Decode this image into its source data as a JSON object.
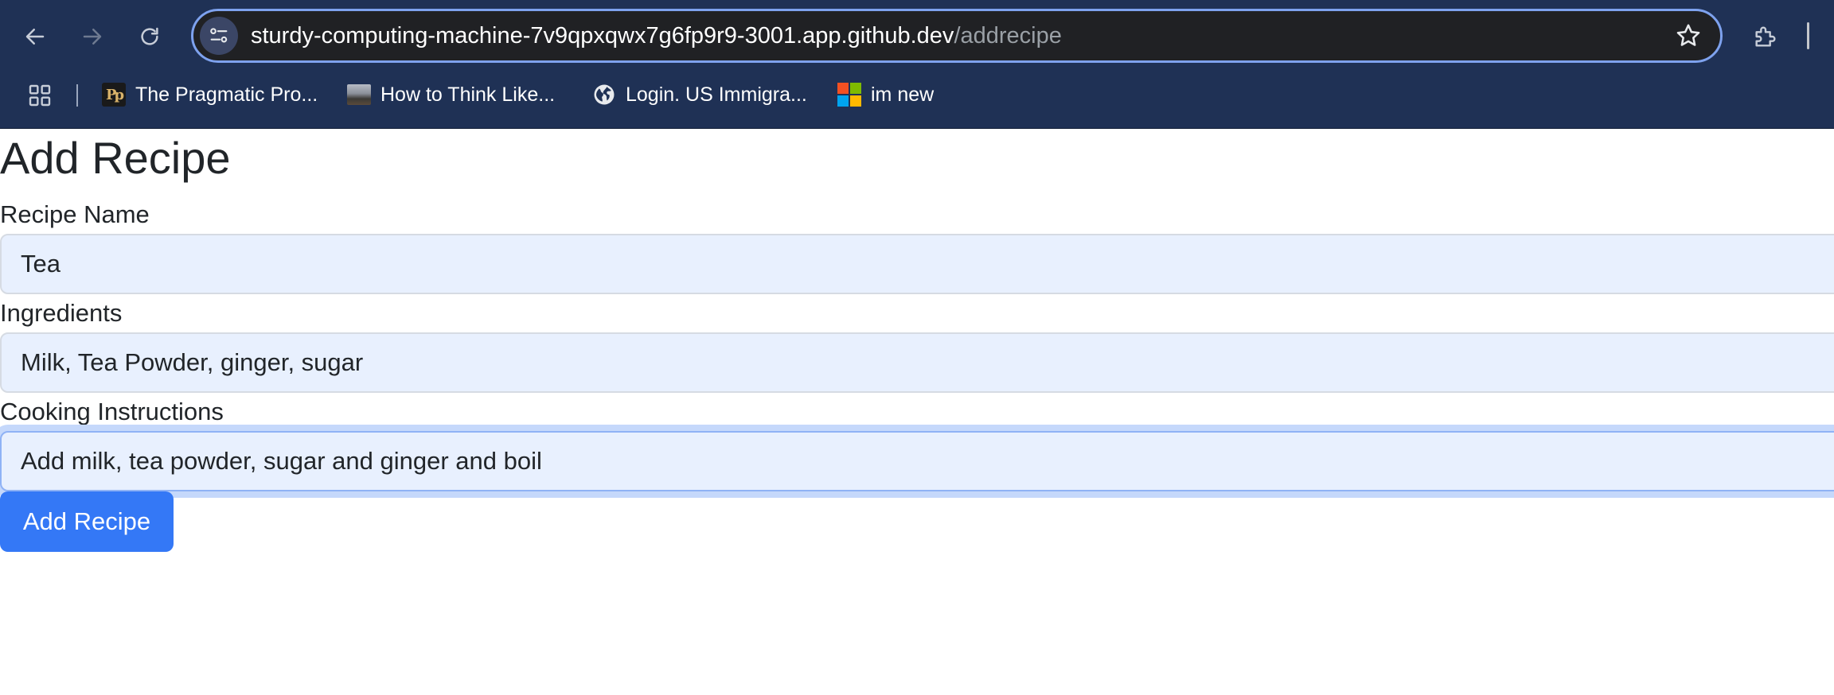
{
  "browser": {
    "url_host": "sturdy-computing-machine-7v9qpxqwx7g6fp9r9-3001.app.github.dev",
    "url_path": "/addrecipe",
    "icons": {
      "back": "arrow-left-icon",
      "forward": "arrow-right-icon",
      "reload": "reload-icon",
      "site_info": "tune-icon",
      "bookmark_star": "star-icon",
      "extensions": "puzzle-icon",
      "apps": "apps-grid-icon"
    },
    "colors": {
      "toolbar_bg": "#1f3155",
      "omnibox_bg": "#202124",
      "omnibox_border": "#7ea2ee"
    }
  },
  "bookmarks": [
    {
      "label": "The Pragmatic Pro...",
      "icon": "pragmatic-programmer-favicon"
    },
    {
      "label": "How to Think Like...",
      "icon": "photo-thumbnail-favicon"
    },
    {
      "label": "Login. US Immigra...",
      "icon": "globe-icon"
    },
    {
      "label": "im new",
      "icon": "microsoft-logo-icon"
    }
  ],
  "page": {
    "title": "Add Recipe",
    "form": {
      "recipe_name": {
        "label": "Recipe Name",
        "value": "Tea"
      },
      "ingredients": {
        "label": "Ingredients",
        "value": "Milk, Tea Powder, ginger, sugar"
      },
      "instructions": {
        "label": "Cooking Instructions",
        "value": "Add milk, tea powder, sugar and ginger and boil"
      }
    },
    "submit_label": "Add Recipe",
    "colors": {
      "input_bg": "#e8f0fe",
      "button_bg": "#3478f6",
      "focus_ring": "#c5d8fb"
    }
  }
}
